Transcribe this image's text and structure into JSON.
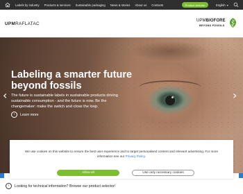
{
  "topbar": {
    "nav": [
      "Labels by industry",
      "Products & services",
      "Sustainable packaging",
      "News & stories",
      "About us",
      "Contacts"
    ],
    "cta_label": "Product selector",
    "language": "English"
  },
  "header": {
    "brand_left_bold": "UPM",
    "brand_left_rest": "RAFLATAC",
    "brand_right_top_a": "UPM",
    "brand_right_top_b": "BIOFORE",
    "brand_right_bottom": "BEYOND FOSSILS"
  },
  "hero": {
    "title": "Labeling a smarter future beyond fossils",
    "text": "The future is sustainable labels in sustainable products driving sustainable consumption - and the future is now. Be the changemaker: make the switch and close the loop.",
    "learn_more": "Learn more"
  },
  "cookie": {
    "text_before": "We use cookies on this website to ensure the best user experience and to target personalised content and relevant advertising. For more information see our ",
    "link": "Privacy Policy",
    "text_after": ".",
    "allow_all": "Allow all",
    "necessary_only": "Use only necessary cookies"
  },
  "bottom": {
    "info": "Looking for technical information? Browse our product selector!"
  },
  "colors": {
    "topbar": "#2f2f2f",
    "accent_green": "#7bbf2f",
    "link_blue": "#2a7bd3"
  },
  "icons": {
    "home": "home-icon",
    "search": "search-icon",
    "prev": "chevron-left-icon",
    "next": "chevron-right-icon",
    "learn": "chevron-right-circle-icon",
    "info": "chevron-right-circle-icon",
    "leaf": "leaf-icon"
  }
}
